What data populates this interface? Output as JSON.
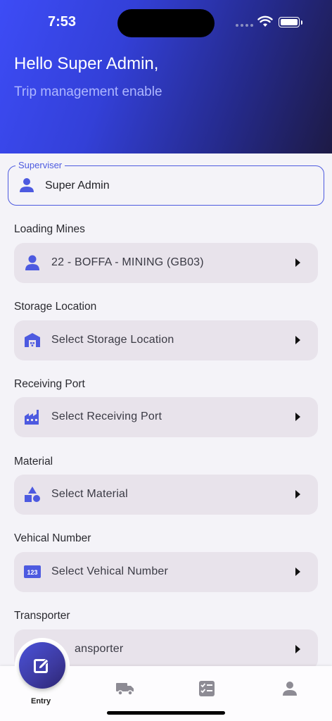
{
  "status_bar": {
    "time": "7:53"
  },
  "header": {
    "greeting": "Hello Super Admin,",
    "subtitle": "Trip management enable"
  },
  "supervisor": {
    "label": "Superviser",
    "value": "Super Admin",
    "icon": "person-icon"
  },
  "fields": [
    {
      "label": "Loading Mines",
      "value": "22 - BOFFA - MINING (GB03)",
      "icon": "person-icon"
    },
    {
      "label": "Storage Location",
      "value": "Select Storage Location",
      "icon": "warehouse-icon"
    },
    {
      "label": "Receiving Port",
      "value": "Select Receiving Port",
      "icon": "factory-icon"
    },
    {
      "label": "Material",
      "value": "Select Material",
      "icon": "shapes-icon"
    },
    {
      "label": "Vehical Number",
      "value": "Select Vehical Number",
      "icon": "number-123-icon",
      "icon_text": "123"
    },
    {
      "label": "Transporter",
      "value": "ansporter",
      "icon": "transporter-icon"
    }
  ],
  "bottom_nav": {
    "items": [
      {
        "label": "Entry",
        "icon": "edit-icon",
        "active": true
      },
      {
        "icon": "truck-icon"
      },
      {
        "icon": "checklist-icon"
      },
      {
        "icon": "profile-icon"
      }
    ]
  },
  "colors": {
    "accent": "#4d5ae0",
    "field_bg": "#e8e3eb",
    "header_start": "#3d4cf6",
    "header_end": "#1d1a45"
  }
}
